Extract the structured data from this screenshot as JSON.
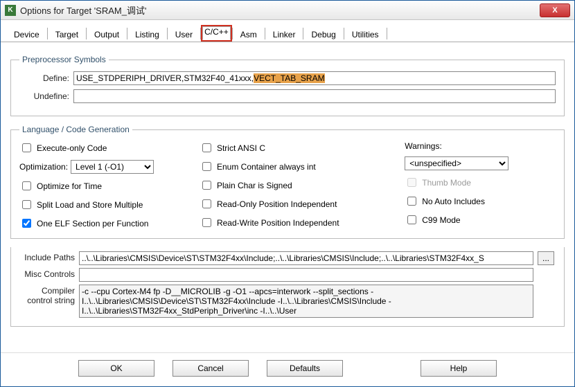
{
  "window": {
    "title": "Options for Target 'SRAM_调试'",
    "close": "X"
  },
  "tabs": {
    "items": [
      "Device",
      "Target",
      "Output",
      "Listing",
      "User",
      "C/C++",
      "Asm",
      "Linker",
      "Debug",
      "Utilities"
    ],
    "selected": 5,
    "highlighted": 5
  },
  "preproc": {
    "legend": "Preprocessor Symbols",
    "define_label": "Define:",
    "define_value_plain": "USE_STDPERIPH_DRIVER,STM32F40_41xxx,",
    "define_value_hl": "VECT_TAB_SRAM",
    "undefine_label": "Undefine:",
    "undefine_value": ""
  },
  "codegen": {
    "legend": "Language / Code Generation",
    "execute_only": "Execute-only Code",
    "optimization_label": "Optimization:",
    "optimization_value": "Level 1 (-O1)",
    "optimize_time": "Optimize for Time",
    "split_load": "Split Load and Store Multiple",
    "one_elf": "One ELF Section per Function",
    "strict_ansi": "Strict ANSI C",
    "enum_container": "Enum Container always int",
    "plain_char": "Plain Char is Signed",
    "ro_pi": "Read-Only Position Independent",
    "rw_pi": "Read-Write Position Independent",
    "warnings_label": "Warnings:",
    "warnings_value": "<unspecified>",
    "thumb_mode": "Thumb Mode",
    "no_auto_inc": "No Auto Includes",
    "c99_mode": "C99 Mode"
  },
  "paths": {
    "include_label": "Include Paths",
    "include_value": "..\\..\\Libraries\\CMSIS\\Device\\ST\\STM32F4xx\\Include;..\\..\\Libraries\\CMSIS\\Include;..\\..\\Libraries\\STM32F4xx_S",
    "misc_label": "Misc Controls",
    "misc_value": "",
    "compiler_label": "Compiler control string",
    "compiler_value": "-c --cpu Cortex-M4 fp -D__MICROLIB -g -O1 --apcs=interwork --split_sections -I..\\..\\Libraries\\CMSIS\\Device\\ST\\STM32F4xx\\Include -I..\\..\\Libraries\\CMSIS\\Include -I..\\..\\Libraries\\STM32F4xx_StdPeriph_Driver\\inc -I..\\..\\User",
    "browse": "..."
  },
  "footer": {
    "ok": "OK",
    "cancel": "Cancel",
    "defaults": "Defaults",
    "help": "Help"
  }
}
